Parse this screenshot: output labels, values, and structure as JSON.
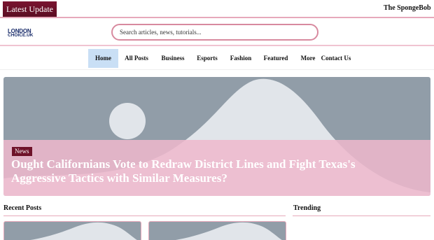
{
  "ticker": {
    "label": "Latest Update",
    "headline": "The SpongeBob"
  },
  "logo": {
    "line1": "LONDON",
    "line2": "CHOICE.UK"
  },
  "search": {
    "placeholder": "Search articles, news, tutorials..."
  },
  "nav": {
    "items": [
      "Home",
      "All Posts",
      "Business",
      "Esports",
      "Fashion",
      "Featured",
      "More",
      "Contact Us"
    ],
    "active": "Home"
  },
  "hero": {
    "category": "News",
    "title": "Ought Californians Vote to Redraw District Lines and Fight Texas's Aggressive Tactics with Similar Measures?"
  },
  "sections": {
    "recent": "Recent Posts",
    "trending": "Trending"
  },
  "colors": {
    "accent": "#6e1229",
    "rule": "#e7a9bb",
    "placeholder_bg": "#919da8",
    "active_nav": "#c9dff5"
  },
  "icons": {
    "placeholder": "image-placeholder-icon"
  }
}
